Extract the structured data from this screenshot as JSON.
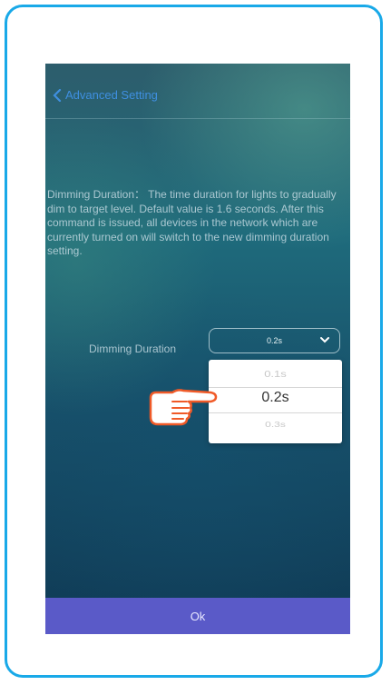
{
  "header": {
    "back_label": "Advanced Setting"
  },
  "description": "Dimming Duration： The time duration for lights to gradually dim to target level.  Default value is 1.6 seconds.  After this command is issued, all devices in the network which are currently turned on will switch to the new dimming duration setting.",
  "dimming": {
    "label": "Dimming Duration",
    "selected": "0.2s",
    "options": [
      "0.1s",
      "0.2s",
      "0.3s"
    ]
  },
  "footer": {
    "ok_label": "Ok"
  },
  "colors": {
    "frame_border": "#19a9e8",
    "ok_button": "#5a5ac8",
    "back_link": "#3f8fe0",
    "hand_outline": "#f05a28"
  },
  "icons": {
    "back": "chevron-left-icon",
    "dropdown": "chevron-down-icon",
    "pointer": "pointing-hand-icon"
  }
}
